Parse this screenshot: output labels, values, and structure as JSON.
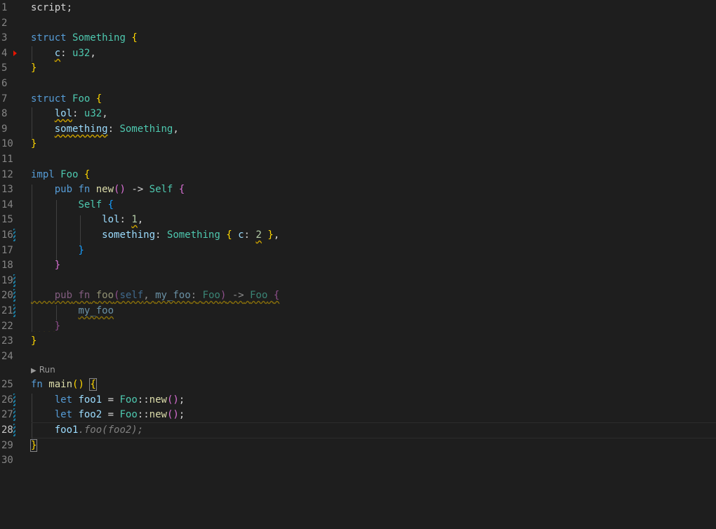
{
  "editor": {
    "line_numbers": [
      "1",
      "2",
      "3",
      "4",
      "5",
      "6",
      "7",
      "8",
      "9",
      "10",
      "11",
      "12",
      "13",
      "14",
      "15",
      "16",
      "17",
      "18",
      "19",
      "20",
      "21",
      "22",
      "23",
      "24",
      "25",
      "26",
      "27",
      "28",
      "29",
      "30"
    ],
    "active_line": "28",
    "codelens_run": "Run",
    "tokens": {
      "l1_script": "script",
      "semi": ";",
      "struct": "struct",
      "something_ty": "Something",
      "foo_ty": "Foo",
      "open_brace": "{",
      "close_brace": "}",
      "c": "c",
      "colon": ":",
      "u32": "u32",
      "comma": ",",
      "lol": "lol",
      "something_field": "something",
      "impl": "impl",
      "pub": "pub",
      "fn": "fn",
      "new": "new",
      "parens": "()",
      "arrow": "->",
      "self_ty": "Self",
      "one": "1",
      "two": "2",
      "foo_fn": "foo",
      "lparen": "(",
      "rparen": ")",
      "self_kw": "self",
      "my_foo": "my_foo",
      "main": "main",
      "let": "let",
      "foo1": "foo1",
      "foo2": "foo2",
      "eq": "=",
      "path": "::",
      "dot": ".",
      "ghost_call": "foo(foo2);"
    }
  }
}
